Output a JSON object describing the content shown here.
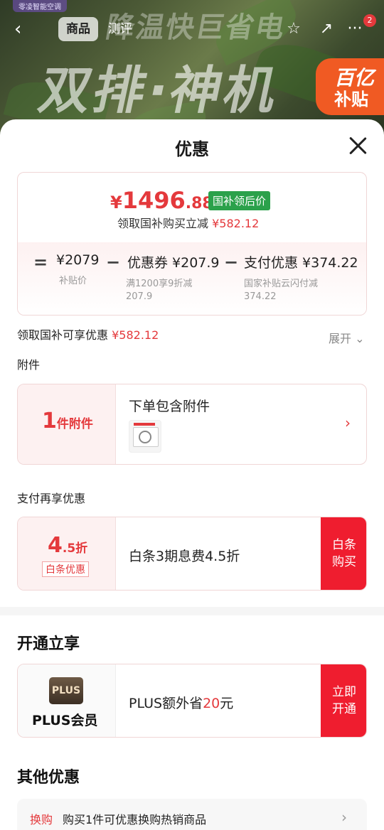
{
  "banner": {
    "tag": "零凌智能空调",
    "headline_top": "降温快巨省电",
    "headline_main": "双排·神机",
    "subsidy_line1": "百亿",
    "subsidy_line2": "补贴"
  },
  "nav": {
    "back_icon": "‹",
    "tab_product": "商品",
    "tab_review": "测评",
    "star_icon": "☆",
    "share_icon": "↗",
    "more_icon": "···",
    "badge_count": "2"
  },
  "sheet": {
    "title": "优惠",
    "price": {
      "currency": "¥",
      "integer": "1496",
      "decimal": ".88",
      "tag": "国补领后价",
      "sub_text": "领取国补购买立减",
      "sub_amount": "¥582.12"
    },
    "calc": {
      "eq": "=",
      "base_value": "¥2079",
      "base_note": "补贴价",
      "minus1": "−",
      "coupon_value": "优惠券 ¥207.9",
      "coupon_note1": "满1200享9折减",
      "coupon_note2": "207.9",
      "minus2": "−",
      "pay_value": "支付优惠 ¥374.22",
      "pay_note1": "国家补贴云闪付减",
      "pay_note2": "374.22"
    },
    "summary_text": "领取国补可享优惠",
    "summary_amount": "¥582.12",
    "expand_label": "展开 ⌄",
    "accessory_label": "附件",
    "accessory": {
      "count": "1",
      "unit": "件附件",
      "title": "下单包含附件",
      "chevron": "›"
    },
    "pay_section_label": "支付再享优惠",
    "baitiao": {
      "discount_num": "4",
      "discount_unit": ".5折",
      "tag": "白条优惠",
      "text": "白条3期息费4.5折",
      "button": "白条购买"
    },
    "open_header": "开通立享",
    "plus": {
      "logo": "PLUS",
      "name": "PLUS会员",
      "text_prefix": "PLUS额外省",
      "text_amount": "20",
      "text_suffix": "元",
      "button": "立即开通"
    },
    "other_header": "其他优惠",
    "other": {
      "tag": "换购",
      "text": "购买1件可优惠换购热销商品",
      "chevron": "›"
    }
  },
  "colors": {
    "accent_red": "#e4393c",
    "button_red": "#ef1d2f",
    "tag_green": "#2ba14b",
    "plus_brown": "#4a3a2c"
  }
}
